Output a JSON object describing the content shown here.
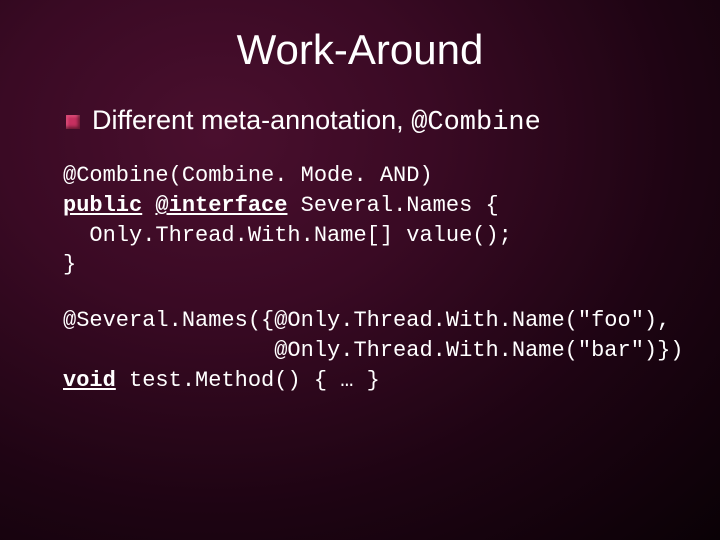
{
  "slide": {
    "title": "Work-Around",
    "bullet": {
      "text_prefix": "Different meta-annotation, ",
      "code_suffix": "@Combine"
    },
    "code1": {
      "l1": "@Combine(Combine. Mode. AND)",
      "l2a": "public",
      "l2b": " ",
      "l2c": "@interface",
      "l2d": " Several.Names {",
      "l3": "  Only.Thread.With.Name[] value();",
      "l4": "}"
    },
    "code2": {
      "l1": "@Several.Names({@Only.Thread.With.Name(\"foo\"),",
      "l2": "                @Only.Thread.With.Name(\"bar\")})",
      "l3a": "void",
      "l3b": " test.Method() { … }"
    }
  }
}
